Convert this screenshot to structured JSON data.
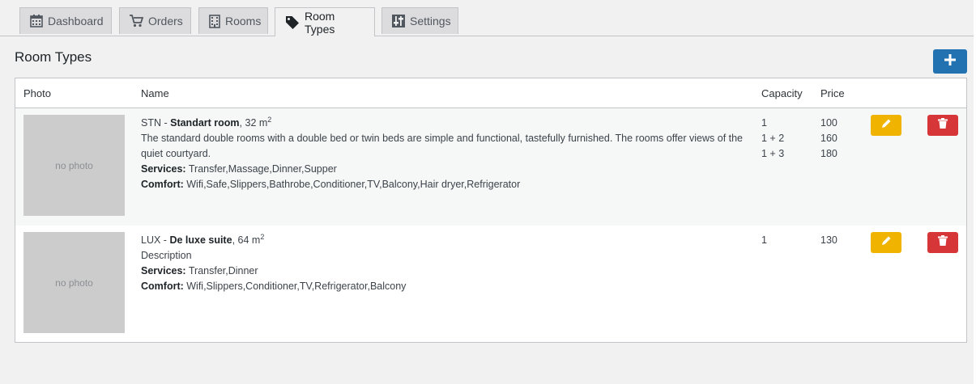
{
  "tabs": [
    {
      "label": "Dashboard",
      "icon": "calendar-icon"
    },
    {
      "label": "Orders",
      "icon": "cart-icon"
    },
    {
      "label": "Rooms",
      "icon": "building-icon"
    },
    {
      "label": "Room Types",
      "icon": "tag-icon",
      "active": true
    },
    {
      "label": "Settings",
      "icon": "sliders-icon"
    }
  ],
  "page": {
    "title": "Room Types",
    "add_icon": "plus-icon"
  },
  "table": {
    "headers": {
      "photo": "Photo",
      "name": "Name",
      "capacity": "Capacity",
      "price": "Price"
    },
    "rows": [
      {
        "photo_text": "no photo",
        "code": "STN",
        "sep": " - ",
        "name": "Standart room",
        "area": ", 32 m",
        "area_sup": "2",
        "description": "The standard double rooms with a double bed or twin beds are simple and functional, tastefully furnished. The rooms offer views of the quiet courtyard.",
        "services_label": "Services:",
        "services": " Transfer,Massage,Dinner,Supper",
        "comfort_label": "Comfort:",
        "comfort": " Wifi,Safe,Slippers,Bathrobe,Conditioner,TV,Balcony,Hair dryer,Refrigerator",
        "capacities": [
          "1",
          "1 + 2",
          "1 + 3"
        ],
        "prices": [
          "100",
          "160",
          "180"
        ]
      },
      {
        "photo_text": "no photo",
        "code": "LUX",
        "sep": " - ",
        "name": "De luxe suite",
        "area": ", 64 m",
        "area_sup": "2",
        "description": "Description",
        "services_label": "Services:",
        "services": " Transfer,Dinner",
        "comfort_label": "Comfort:",
        "comfort": " Wifi,Slippers,Conditioner,TV,Refrigerator,Balcony",
        "capacities": [
          "1"
        ],
        "prices": [
          "130"
        ]
      }
    ]
  },
  "colors": {
    "primary": "#2271b1",
    "edit": "#f0b400",
    "delete": "#d63638"
  }
}
